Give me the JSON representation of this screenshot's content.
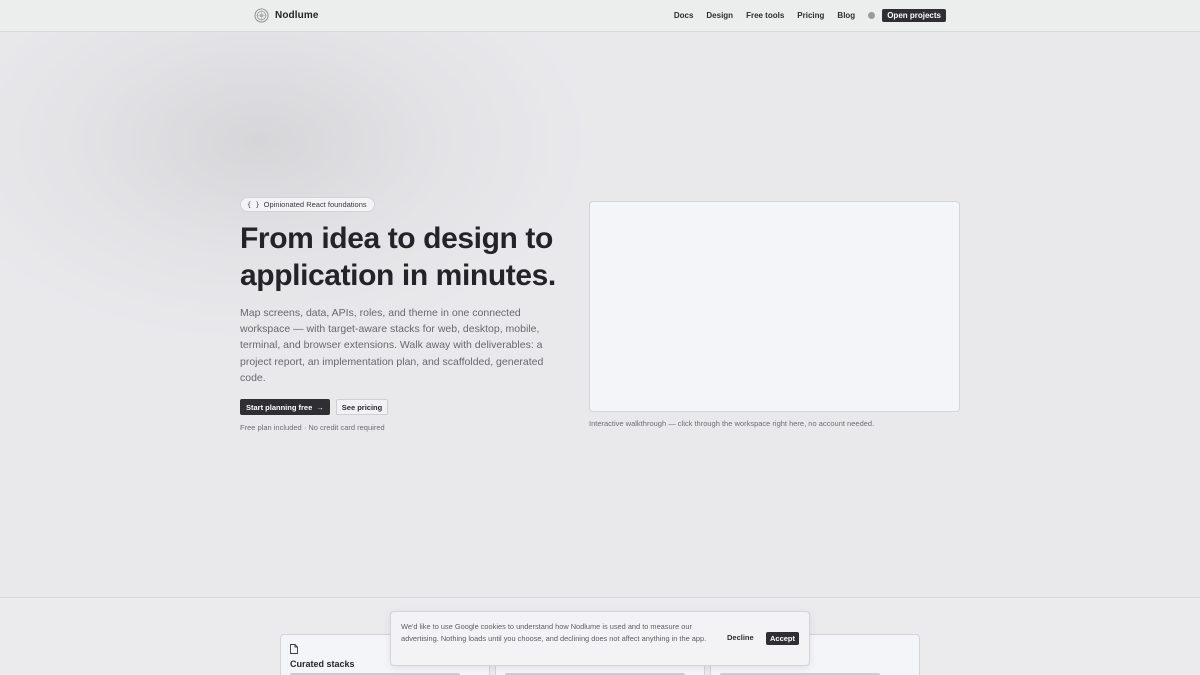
{
  "header": {
    "brand": "Nodlume",
    "logo_icon": "nodlume-logo-icon",
    "nav": [
      "Docs",
      "Design",
      "Free tools",
      "Pricing",
      "Blog"
    ],
    "theme_toggle_icon": "theme-toggle-icon",
    "open_projects": "Open projects"
  },
  "hero": {
    "badge_icon": "{ }",
    "badge": "Opinionated React foundations",
    "headline": "From idea to design to application in minutes.",
    "subtext": "Map screens, data, APIs, roles, and theme in one connected workspace — with target-aware stacks for web, desktop, mobile, terminal, and browser extensions. Walk away with deliverables: a project report, an implementation plan, and scaffolded, generated code.",
    "primary_cta": "Start planning free",
    "primary_cta_arrow": "→",
    "secondary_cta": "See pricing",
    "footnote": "Free plan included · No credit card required",
    "preview_caption": "Interactive walkthrough — click through the workspace right here, no account needed."
  },
  "features": {
    "cards": [
      {
        "icon": "document-icon",
        "title": "Curated stacks"
      },
      {
        "icon": "",
        "title": ""
      },
      {
        "icon": "",
        "title": ""
      }
    ]
  },
  "cookie_banner": {
    "text": "We'd like to use Google cookies to understand how Nodlume is used and to measure our advertising. Nothing loads until you choose, and declining does not affect anything in the app.",
    "decline": "Decline",
    "accept": "Accept"
  },
  "colors": {
    "background": "#e9e9ec",
    "primary_button": "#2f2f33",
    "text": "#242428",
    "muted_text": "#68686e"
  }
}
